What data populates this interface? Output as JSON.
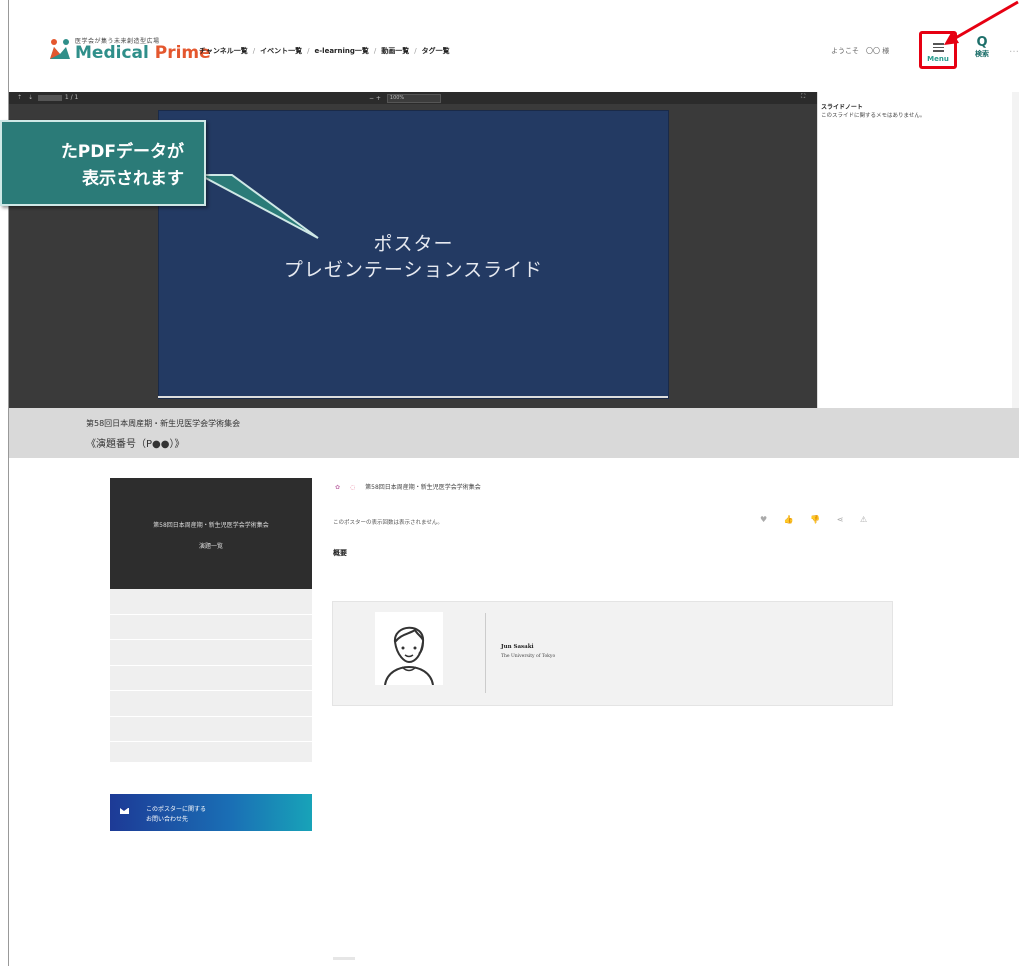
{
  "header": {
    "logo_tagline": "医学会が集う未来創造型広場",
    "logo_text_1": "Medical",
    "logo_text_2": "Prime",
    "nav": [
      "チャンネル一覧",
      "イベント一覧",
      "e-learning一覧",
      "動画一覧",
      "タグ一覧"
    ],
    "nav_sep": "/",
    "welcome": "ようこそ　〇〇 様",
    "menu_label": "Menu",
    "search_icon": "Q",
    "search_label": "検索",
    "more": "…"
  },
  "viewer": {
    "page_display": "1 / 1",
    "zoom_controls": "−  +",
    "zoom_value": "100%",
    "slide_line1": "ポスター",
    "slide_line2": "プレゼンテーションスライド",
    "notes_title": "スライドノート",
    "notes_body": "このスライドに関するメモはありません。"
  },
  "callout": {
    "line1": "たPDFデータが",
    "line2": "表示されます"
  },
  "band": {
    "event": "第58回日本周産期・新生児医学会学術集会",
    "presentation_no": "《演題番号（P●●）》"
  },
  "sidebar": {
    "event": "第58回日本周産期・新生児医学会学術集会",
    "list_label": "演題一覧",
    "contact_line1": "このポスターに関する",
    "contact_line2": "お問い合わせ先"
  },
  "main": {
    "crumb_event": "第58回日本周産期・新生児医学会学術集会",
    "views_text": "このポスターの表示回数は表示されません。",
    "overview": "概要",
    "author_name": "Jun Sasaki",
    "author_affiliation": "The University of Tokyo"
  },
  "colors": {
    "accent_red": "#e60012",
    "brand_teal": "#2f8f8a",
    "slide_bg": "#233a63"
  }
}
